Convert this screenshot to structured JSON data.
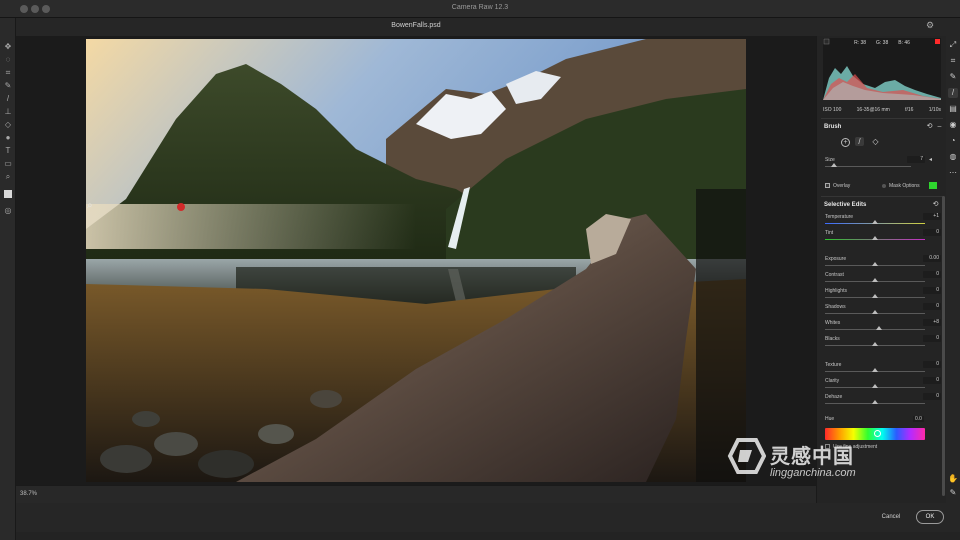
{
  "app": {
    "window_title": "Camera Raw 12.3",
    "document_title": "BowenFalls.psd"
  },
  "histogram": {
    "r": "R: 38",
    "g": "G: 38",
    "b": "B: 46"
  },
  "camera_info": {
    "iso": "ISO 100",
    "lens": "16-35@16 mm",
    "aperture": "f/16",
    "shutter": "1/10s"
  },
  "brush": {
    "title": "Brush",
    "size_label": "Size",
    "size_value": "7",
    "size_level": 0.1,
    "overlay_label": "Overlay",
    "mask_options_label": "Mask Options",
    "mask_color": "#2ed52e"
  },
  "selective_edits": {
    "title": "Selective Edits",
    "sliders": [
      {
        "label": "Temperature",
        "value": "+1",
        "level": 0.5
      },
      {
        "label": "Tint",
        "value": "0",
        "level": 0.5
      },
      {
        "label": "Exposure",
        "value": "0.00",
        "level": 0.5
      },
      {
        "label": "Contrast",
        "value": "0",
        "level": 0.5
      },
      {
        "label": "Highlights",
        "value": "0",
        "level": 0.5
      },
      {
        "label": "Shadows",
        "value": "0",
        "level": 0.5
      },
      {
        "label": "Whites",
        "value": "+8",
        "level": 0.54
      },
      {
        "label": "Blacks",
        "value": "0",
        "level": 0.5
      },
      {
        "label": "Texture",
        "value": "0",
        "level": 0.5
      },
      {
        "label": "Clarity",
        "value": "0",
        "level": 0.5
      },
      {
        "label": "Dehaze",
        "value": "0",
        "level": 0.5
      }
    ],
    "hue_label": "Hue",
    "hue_value": "0.0",
    "fine_adjust_label": "Use fine adjustment"
  },
  "footer": {
    "zoom": "38.7%",
    "cancel": "Cancel",
    "ok": "OK"
  },
  "watermark": {
    "cn": "灵感中国",
    "en": "lingganchina.com"
  },
  "colors": {
    "accent": "#2ed52e",
    "histogram_warning": "#ff2a2a"
  }
}
